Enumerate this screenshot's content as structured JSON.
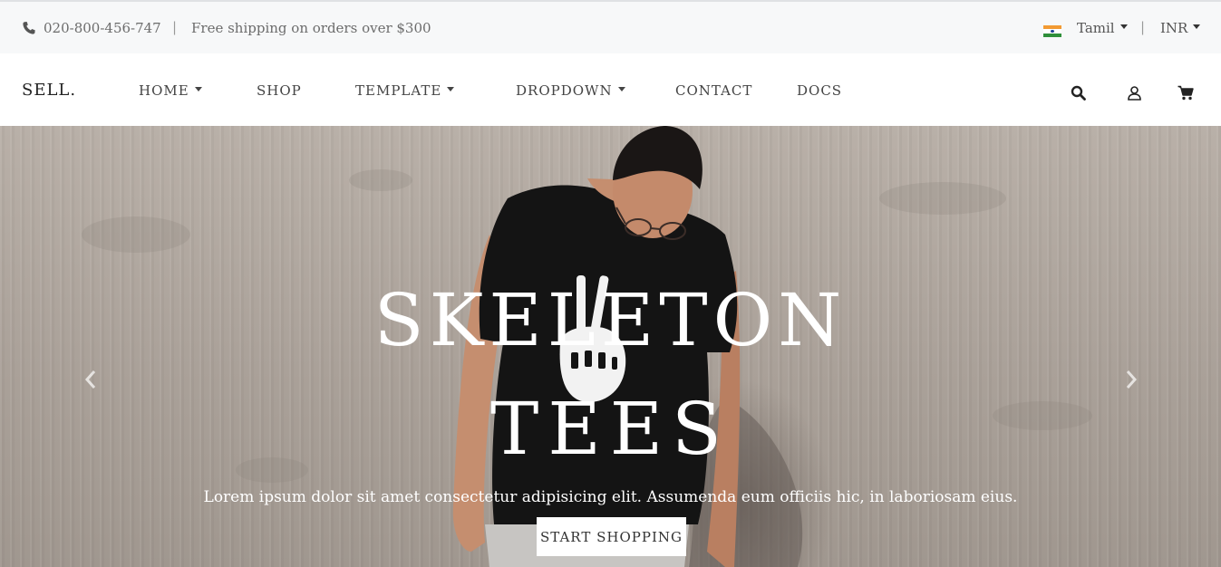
{
  "topbar": {
    "phone": "020-800-456-747",
    "separator": "|",
    "shipping_text": "Free shipping on orders over $300",
    "language": "Tamil",
    "currency": "INR"
  },
  "navbar": {
    "brand": "SELL.",
    "items": [
      {
        "label": "HOME",
        "has_dropdown": true
      },
      {
        "label": "SHOP",
        "has_dropdown": false
      },
      {
        "label": "TEMPLATE",
        "has_dropdown": true
      },
      {
        "label": "DROPDOWN",
        "has_dropdown": true
      },
      {
        "label": "CONTACT",
        "has_dropdown": false
      },
      {
        "label": "DOCS",
        "has_dropdown": false
      }
    ],
    "icons": [
      "search-icon",
      "user-icon",
      "cart-icon"
    ]
  },
  "hero": {
    "title_line1": "SKELETON",
    "title_line2": "TEES",
    "subtitle": "Lorem ipsum dolor sit amet consectetur adipisicing elit. Assumenda eum officiis hic, in laboriosam eius.",
    "cta_label": "START SHOPPING",
    "prev_icon": "chevron-left-icon",
    "next_icon": "chevron-right-icon"
  },
  "colors": {
    "topbar_bg": "#f7f8f9",
    "navbar_bg": "#ffffff",
    "hero_wall": "#aaa199",
    "text_dark": "#333333",
    "hero_text": "#ffffff"
  }
}
